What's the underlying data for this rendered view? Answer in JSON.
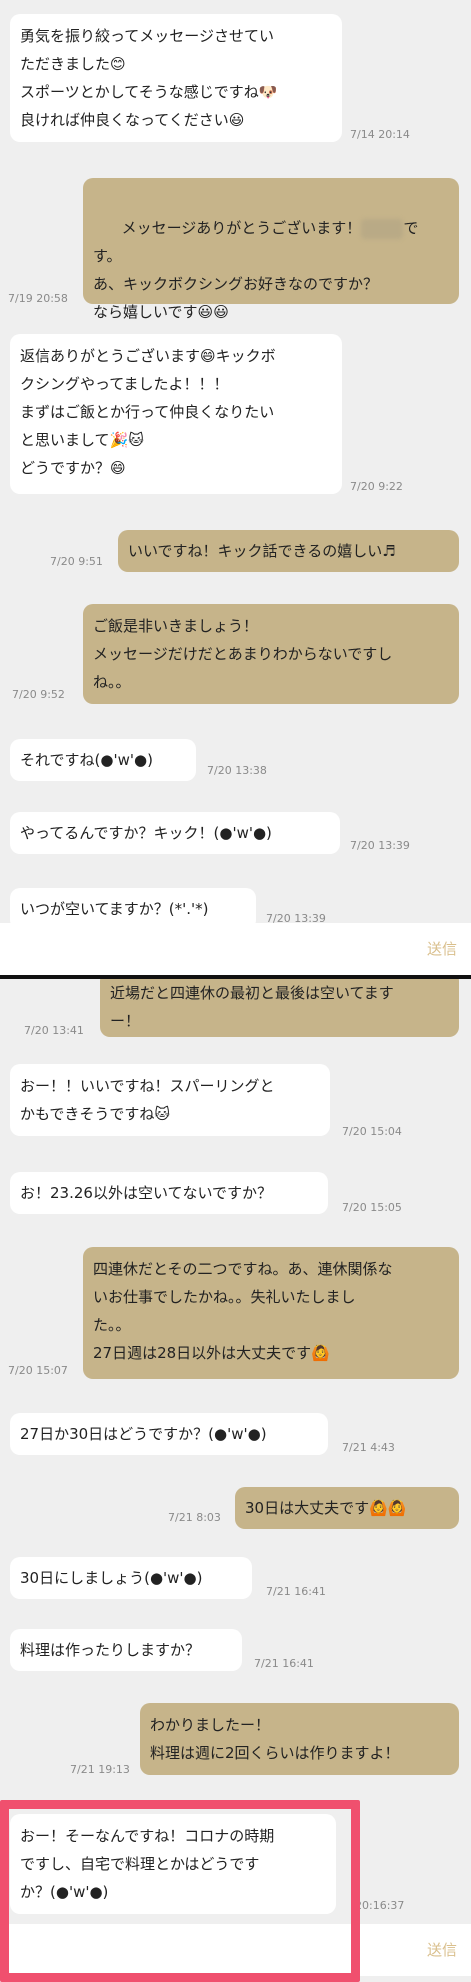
{
  "send_label": "送信",
  "colors": {
    "outgoing": "#c6b48a",
    "incoming": "#ffffff",
    "highlight": "#f0506e",
    "send": "#d9bf8c"
  },
  "panel1": {
    "messages": [
      {
        "dir": "in",
        "text": "勇気を振り絞ってメッセージさせてい\nただきました😊\nスポーツとかしてそうな感じですね🐶\n良ければ仲良くなってください😃",
        "time": "7/14 20:14"
      },
      {
        "dir": "out",
        "text_a": "メッセージありがとうございます！",
        "text_b": "で\nす。\nあ、キックボクシングお好きなのですか？\nなら嬉しいです😃😃",
        "time": "7/19 20:58"
      },
      {
        "dir": "in",
        "text": "返信ありがとうございます😄キックボ\nクシングやってましたよ！！！\nまずはご飯とか行って仲良くなりたい\nと思いまして🎉🐱\nどうですか？😄",
        "time": "7/20 9:22"
      },
      {
        "dir": "out",
        "text": "いいですね！キック話できるの嬉しい♬",
        "time": "7/20 9:51"
      },
      {
        "dir": "out",
        "text": "ご飯是非いきましょう！\nメッセージだけだとあまりわからないですし\nね。。",
        "time": "7/20 9:52"
      },
      {
        "dir": "in",
        "text": "それですね(●'w'●)",
        "time": "7/20 13:38"
      },
      {
        "dir": "in",
        "text": "やってるんですか？キック！(●'w'●)",
        "time": "7/20 13:39"
      },
      {
        "dir": "in",
        "text": "いつが空いてますか？(*'.'*)",
        "time": "7/20 13:39"
      }
    ]
  },
  "panel2": {
    "messages": [
      {
        "dir": "out",
        "text": "近場だと四連休の最初と最後は空いてます\nー！",
        "time": "7/20 13:41"
      },
      {
        "dir": "in",
        "text": "おー！！いいですね！スパーリングと\nかもできそうですね🐱",
        "time": "7/20 15:04"
      },
      {
        "dir": "in",
        "text": "お！23.26以外は空いてないですか？",
        "time": "7/20 15:05"
      },
      {
        "dir": "out",
        "text": "四連休だとその二つですね。あ、連休関係な\nいお仕事でしたかね。。失礼いたしまし\nた。。\n27日週は28日以外は大丈夫です🙆",
        "time": "7/20 15:07"
      },
      {
        "dir": "in",
        "text": "27日か30日はどうですか？(●'w'●)",
        "time": "7/21 4:43"
      },
      {
        "dir": "out",
        "text": "30日は大丈夫です🙆🙆",
        "time": "7/21 8:03"
      },
      {
        "dir": "in",
        "text": "30日にしましょう(●'w'●)",
        "time": "7/21 16:41"
      },
      {
        "dir": "in",
        "text": "料理は作ったりしますか？",
        "time": "7/21 16:41"
      },
      {
        "dir": "out",
        "text": "わかりましたー！\n料理は週に2回くらいは作りますよ！",
        "time": "7/21 19:13"
      },
      {
        "dir": "in",
        "text": "おー！そーなんですね！コロナの時期\nですし、自宅で料理とかはどうです\nか？(●'w'●)",
        "time": "20:16:37"
      }
    ]
  }
}
